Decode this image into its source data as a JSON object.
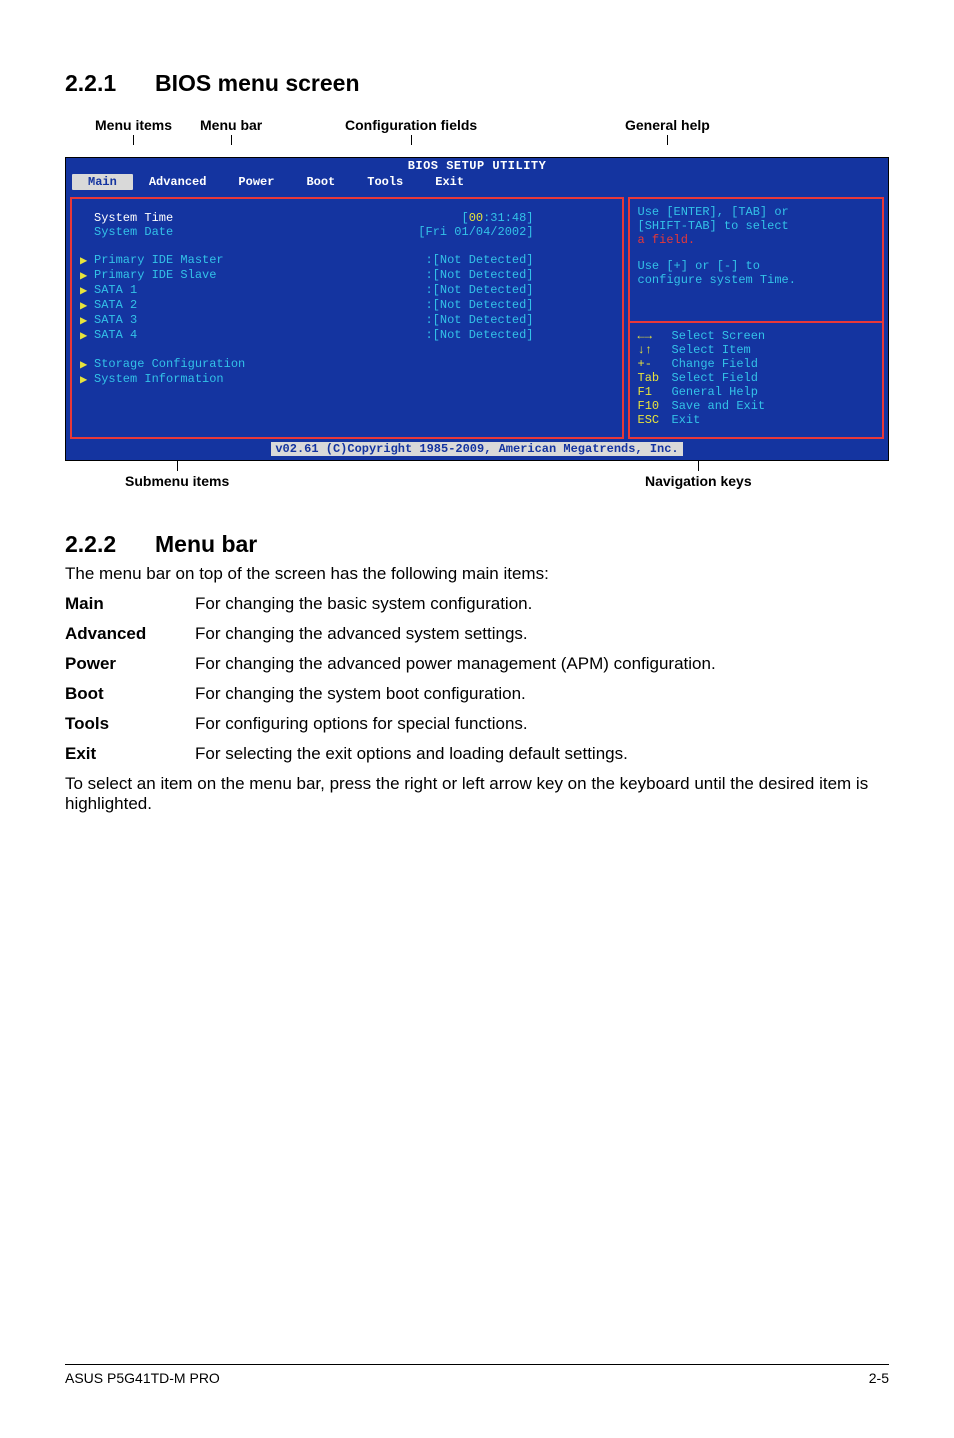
{
  "section1": {
    "num": "2.2.1",
    "title": "BIOS menu screen"
  },
  "top_labels": {
    "menu_items": "Menu items",
    "menu_bar": "Menu bar",
    "config_fields": "Configuration fields",
    "general_help": "General help"
  },
  "bios": {
    "title": "BIOS SETUP UTILITY",
    "tabs": [
      "Main",
      "Advanced",
      "Power",
      "Boot",
      "Tools",
      "Exit"
    ],
    "left": {
      "system_time": {
        "label": "System Time",
        "val_open": "[",
        "hh": "00",
        "rest": ":31:48]"
      },
      "system_date": {
        "label": "System Date",
        "val": "[Fri 01/04/2002]"
      },
      "items": [
        {
          "label": "Primary IDE Master",
          "val": ":[Not Detected]"
        },
        {
          "label": "Primary IDE Slave",
          "val": ":[Not Detected]"
        },
        {
          "label": "SATA 1",
          "val": ":[Not Detected]"
        },
        {
          "label": "SATA 2",
          "val": ":[Not Detected]"
        },
        {
          "label": "SATA 3",
          "val": ":[Not Detected]"
        },
        {
          "label": "SATA 4",
          "val": ":[Not Detected]"
        }
      ],
      "storage": "Storage Configuration",
      "sysinfo": "System Information"
    },
    "help": {
      "l1": "Use [ENTER], [TAB] or",
      "l2": "[SHIFT-TAB] to select",
      "l3": "a field.",
      "l4": "Use [+] or [-] to",
      "l5": "configure system Time."
    },
    "nav": [
      {
        "k": "←→",
        "t": "Select Screen"
      },
      {
        "k": "↓↑",
        "t": "Select Item"
      },
      {
        "k": "+-",
        "t": "Change Field"
      },
      {
        "k": "Tab",
        "t": "Select Field"
      },
      {
        "k": "F1",
        "t": "General Help"
      },
      {
        "k": "F10",
        "t": "Save and Exit"
      },
      {
        "k": "ESC",
        "t": "Exit"
      }
    ],
    "footer": "v02.61 (C)Copyright 1985-2009, American Megatrends, Inc."
  },
  "bottom_labels": {
    "submenu": "Submenu items",
    "navkeys": "Navigation keys"
  },
  "section2": {
    "num": "2.2.2",
    "title": "Menu bar"
  },
  "menubar_desc": "The menu bar on top of the screen has the following main items:",
  "menu_defs": [
    {
      "t": "Main",
      "d": "For changing the basic system configuration."
    },
    {
      "t": "Advanced",
      "d": "For changing the advanced system settings."
    },
    {
      "t": "Power",
      "d": "For changing the advanced power management (APM) configuration."
    },
    {
      "t": "Boot",
      "d": "For changing the system boot configuration."
    },
    {
      "t": "Tools",
      "d": "For configuring options for special functions."
    },
    {
      "t": "Exit",
      "d": "For selecting the exit options and loading default settings."
    }
  ],
  "after_text": "To select an item on the menu bar, press the right or left arrow key on the keyboard until the desired item is highlighted.",
  "footer": {
    "left": "ASUS P5G41TD-M PRO",
    "right": "2-5"
  }
}
